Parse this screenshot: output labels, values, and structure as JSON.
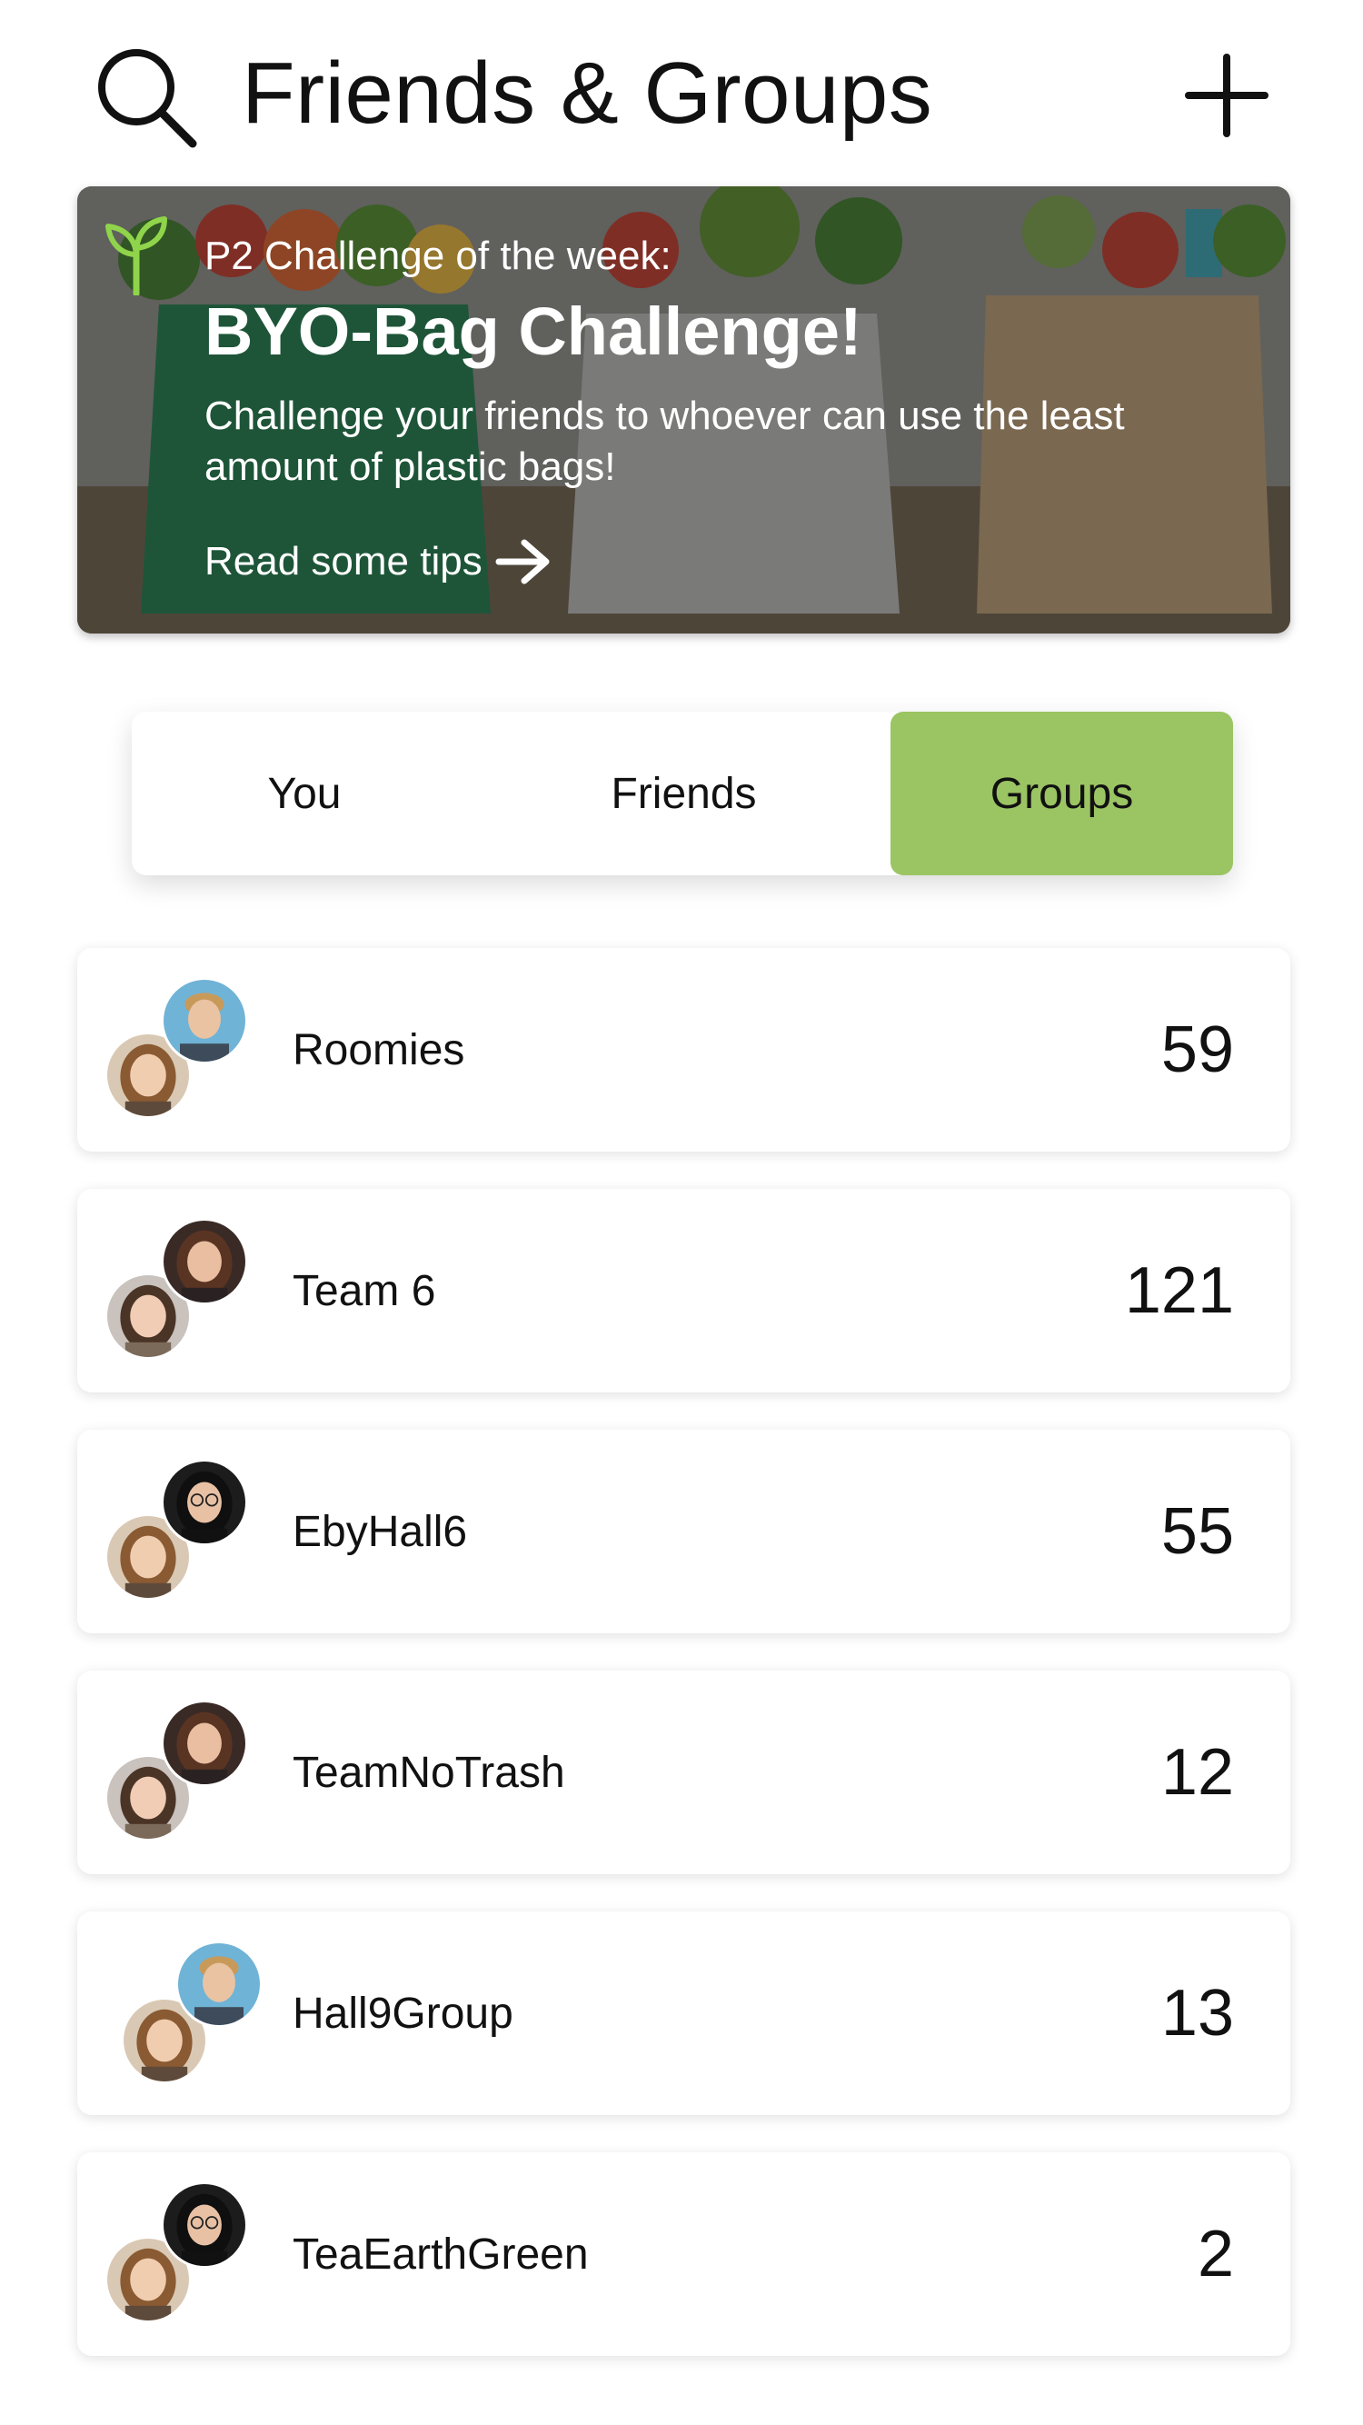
{
  "header": {
    "title": "Friends & Groups",
    "search_icon": "search-icon",
    "add_icon": "plus-icon"
  },
  "banner": {
    "kicker": "P2 Challenge of the week:",
    "title": "BYO-Bag Challenge!",
    "description": "Challenge your friends to whoever can use the least amount of plastic bags!",
    "link_label": "Read some tips",
    "link_icon": "arrow-right-icon",
    "badge_icon": "sprout-icon",
    "accent_color": "#7fbf3f"
  },
  "tabs": {
    "items": [
      {
        "label": "You",
        "active": false
      },
      {
        "label": "Friends",
        "active": false
      },
      {
        "label": "Groups",
        "active": true
      }
    ],
    "active_color": "#9bc463"
  },
  "groups": [
    {
      "name": "Roomies",
      "score": "59",
      "avatars": [
        "woman-blonde-avatar",
        "man-blonde-avatar"
      ]
    },
    {
      "name": "Team 6",
      "score": "121",
      "avatars": [
        "woman-brunette-avatar",
        "woman-darkhair-avatar"
      ]
    },
    {
      "name": "EbyHall6",
      "score": "55",
      "avatars": [
        "woman-blonde-avatar",
        "woman-glasses-avatar"
      ]
    },
    {
      "name": "TeamNoTrash",
      "score": "12",
      "avatars": [
        "woman-brunette-avatar",
        "woman-darkhair-avatar"
      ]
    },
    {
      "name": "Hall9Group",
      "score": "13",
      "avatars": [
        "woman-blonde-avatar",
        "man-blonde-avatar"
      ]
    },
    {
      "name": "TeaEarthGreen",
      "score": "2",
      "avatars": [
        "woman-blonde-avatar",
        "woman-glasses-avatar"
      ]
    }
  ]
}
